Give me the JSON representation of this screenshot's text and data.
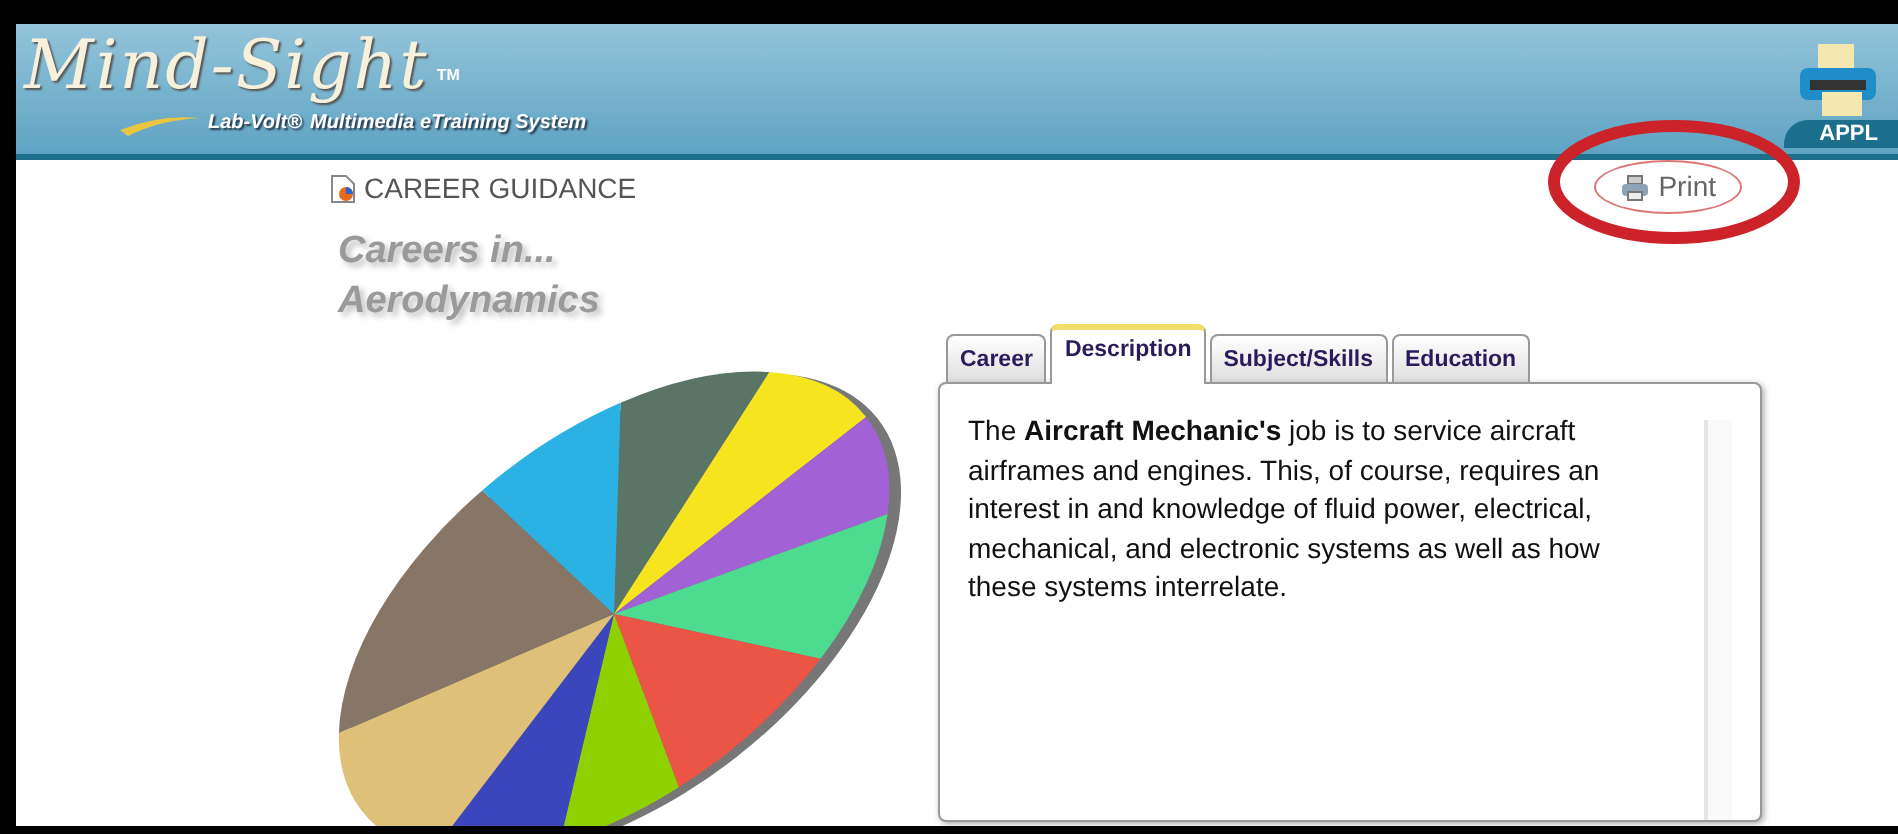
{
  "header": {
    "logo_title": "Mind-Sight",
    "logo_tm": "TM",
    "brand": "Lab-Volt®",
    "tagline": "Multimedia eTraining System",
    "right_tab": "APPL"
  },
  "section": {
    "label": "CAREER GUIDANCE",
    "print": "Print",
    "title_line1": "Careers in...",
    "title_line2": "Aerodynamics"
  },
  "tabs": [
    {
      "label": "Career",
      "selected": false
    },
    {
      "label": "Description",
      "selected": true
    },
    {
      "label": "Subject/Skills",
      "selected": false
    },
    {
      "label": "Education",
      "selected": false
    }
  ],
  "description": "The **Aircraft Mechanic's** job is to service aircraft airframes and engines.  This, of course, requires an interest in and knowledge of fluid power, electrical, mechanical, and electronic systems as well as how these systems interrelate."
}
